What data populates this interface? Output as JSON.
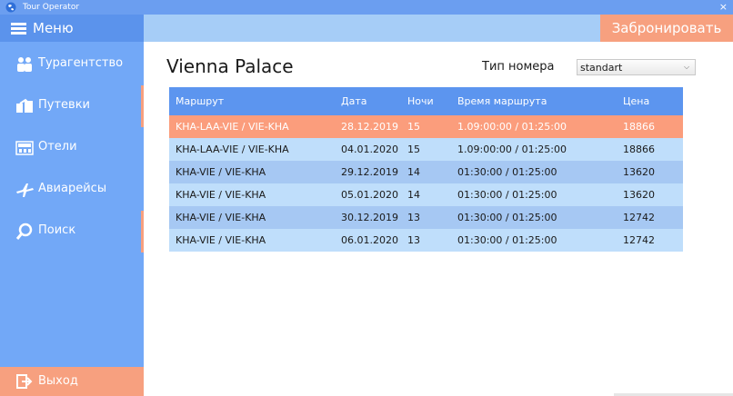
{
  "window": {
    "title": "Tour Operator",
    "close_glyph": "×"
  },
  "sidebar": {
    "menu_label": "Меню",
    "items": [
      {
        "label": "Турагентство",
        "icon": "people-icon"
      },
      {
        "label": "Путевки",
        "icon": "handshake-icon"
      },
      {
        "label": "Отели",
        "icon": "hotel-icon"
      },
      {
        "label": "Авиарейсы",
        "icon": "plane-icon"
      },
      {
        "label": "Поиск",
        "icon": "search-icon"
      }
    ],
    "logout_label": "Выход"
  },
  "topbar": {
    "book_label": "Забронировать"
  },
  "main": {
    "hotel_name": "Vienna Palace",
    "room_type_label": "Тип номера",
    "room_type_value": "standart"
  },
  "table": {
    "headers": [
      "Маршрут",
      "Дата",
      "Ночи",
      "Время маршрута",
      "Цена"
    ],
    "rows": [
      [
        "KHA-LAA-VIE / VIE-KHA",
        "28.12.2019",
        "15",
        "1.09:00:00 / 01:25:00",
        "18866"
      ],
      [
        "KHA-LAA-VIE / VIE-KHA",
        "04.01.2020",
        "15",
        "1.09:00:00 / 01:25:00",
        "18866"
      ],
      [
        "KHA-VIE / VIE-KHA",
        "29.12.2019",
        "14",
        "01:30:00 / 01:25:00",
        "13620"
      ],
      [
        "KHA-VIE / VIE-KHA",
        "05.01.2020",
        "14",
        "01:30:00 / 01:25:00",
        "13620"
      ],
      [
        "KHA-VIE / VIE-KHA",
        "30.12.2019",
        "13",
        "01:30:00 / 01:25:00",
        "12742"
      ],
      [
        "KHA-VIE / VIE-KHA",
        "06.01.2020",
        "13",
        "01:30:00 / 01:25:00",
        "12742"
      ]
    ]
  },
  "colors": {
    "accent": "#f7a07f",
    "sidebar": "#72a8f7",
    "header": "#5c95ef",
    "row_light": "#bfdefb",
    "row_dark": "#a6c8f3"
  }
}
